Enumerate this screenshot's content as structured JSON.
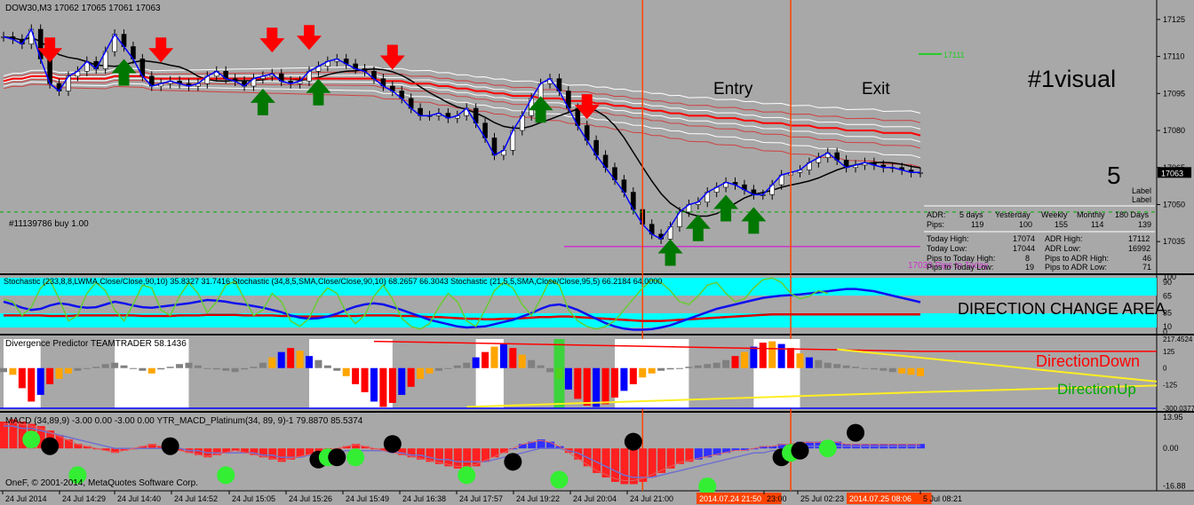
{
  "window": {
    "header": "DOW30,M3  17062 17065 17061 17063"
  },
  "price_axis": {
    "labels": [
      "17125",
      "17110",
      "17095",
      "17080",
      "17065",
      "17050",
      "17035"
    ],
    "current_price": "17063",
    "level_label": "17111"
  },
  "order_line": {
    "label": "#11139786 buy 1.00"
  },
  "pivot_line": {
    "label": "17033 Pips to Today"
  },
  "annotations": {
    "entry": "Entry",
    "exit": "Exit",
    "brand": "#1visual",
    "five": "5",
    "label1": "Label",
    "label2": "Label",
    "direction_change": "DIRECTION CHANGE AREA",
    "direction_down": "DirectionDown",
    "direction_up": "DirectionUp",
    "copyright": "OneF, © 2001-2014, MetaQuotes Software Corp."
  },
  "adr_panel": {
    "header": [
      "ADR:",
      "5 days",
      "Yesterday",
      "Weekly",
      "Monthly",
      "180 Days"
    ],
    "pips": [
      "Pips:",
      "119",
      "100",
      "155",
      "114",
      "139"
    ],
    "rows": [
      [
        "Today High:",
        "17074",
        "ADR High:",
        "17112"
      ],
      [
        "Today Low:",
        "17044",
        "ADR Low:",
        "16992"
      ],
      [
        "Pips to Today High:",
        "8",
        "Pips to ADR High:",
        "46"
      ],
      [
        "Pips to Today Low:",
        "19",
        "Pips to ADR Low:",
        "71"
      ]
    ]
  },
  "indicator_titles": {
    "stochastic": "Stochastic (233,8,8,LWMA,Close/Close,90,10) 35.8327 31.7416  Stochastic (34,8,5,SMA,Close/Close,90,10) 68.2657 66.3043  Stochastic (21,5,5,SMA,Close/Close,95,5) 66.2184 64.0000",
    "divergence": "Divergence Predictor TEAMTRADER 58.1436",
    "macd": "MACD (34,89,9) -3.00 0.00 -3.00 0.00  YTR_MACD_Platinum(34, 89, 9)-1 79.8870 85.5374"
  },
  "stoch_axis": [
    "100",
    "90",
    "65",
    "35",
    "10",
    "0"
  ],
  "div_axis": [
    "217.4524",
    "125",
    "0",
    "-125",
    "-300.0377"
  ],
  "macd_axis": [
    "13.95",
    "0.00",
    "-16.88"
  ],
  "time_axis": [
    "24 Jul 2014",
    "24 Jul 14:29",
    "24 Jul 14:40",
    "24 Jul 14:52",
    "24 Jul 15:05",
    "24 Jul 15:26",
    "24 Jul 15:49",
    "24 Jul 16:38",
    "24 Jul 17:57",
    "24 Jul 19:22",
    "24 Jul 20:04",
    "24 Jul 21:00",
    "2014.07.24 21:50",
    "23:00",
    "25 Jul 02:23",
    "2014.07.25 08:06",
    "5 Jul 08:21"
  ],
  "chart_data": {
    "type": "line",
    "title": "DOW30,M3",
    "ylim": [
      17025,
      17130
    ],
    "x_count": 100,
    "price_series": [
      17118,
      17117,
      17115,
      17121,
      17109,
      17099,
      17096,
      17102,
      17104,
      17108,
      17105,
      17112,
      17119,
      17114,
      17109,
      17102,
      17098,
      17099,
      17100,
      17099,
      17098,
      17099,
      17102,
      17104,
      17101,
      17100,
      17098,
      17101,
      17102,
      17103,
      17100,
      17099,
      17100,
      17104,
      17106,
      17108,
      17109,
      17107,
      17105,
      17104,
      17101,
      17098,
      17096,
      17093,
      17089,
      17086,
      17086,
      17087,
      17085,
      17086,
      17089,
      17083,
      17077,
      17070,
      17072,
      17080,
      17086,
      17093,
      17099,
      17101,
      17096,
      17089,
      17082,
      17076,
      17070,
      17065,
      17060,
      17055,
      17048,
      17042,
      17038,
      17036,
      17041,
      17047,
      17050,
      17051,
      17055,
      17057,
      17059,
      17058,
      17056,
      17054,
      17054,
      17058,
      17062,
      17063,
      17064,
      17067,
      17069,
      17071,
      17068,
      17065,
      17066,
      17067,
      17066,
      17065,
      17065,
      17064,
      17063,
      17063
    ],
    "ema_red": [
      17100,
      17101,
      17101,
      17102,
      17102,
      17102,
      17101,
      17101,
      17101,
      17101,
      17101,
      17101,
      17102,
      17102,
      17102,
      17102,
      17101,
      17101,
      17101,
      17101,
      17101,
      17101,
      17101,
      17101,
      17101,
      17101,
      17101,
      17101,
      17101,
      17101,
      17101,
      17101,
      17101,
      17101,
      17101,
      17101,
      17101,
      17101,
      17101,
      17101,
      17101,
      17100,
      17100,
      17100,
      17099,
      17099,
      17099,
      17098,
      17098,
      17097,
      17097,
      17096,
      17096,
      17095,
      17095,
      17094,
      17094,
      17094,
      17093,
      17093,
      17093,
      17092,
      17092,
      17092,
      17091,
      17091,
      17090,
      17090,
      17089,
      17089,
      17088,
      17088,
      17087,
      17087,
      17086,
      17086,
      17086,
      17085,
      17085,
      17085,
      17084,
      17084,
      17083,
      17083,
      17083,
      17082,
      17082,
      17082,
      17081,
      17081,
      17081,
      17080,
      17080,
      17080,
      17080,
      17079,
      17079,
      17079,
      17079,
      17078
    ],
    "entry_index": 69,
    "exit_index": 85,
    "signals": [
      {
        "type": "sell",
        "i": 5
      },
      {
        "type": "buy",
        "i": 13
      },
      {
        "type": "sell",
        "i": 17
      },
      {
        "type": "sell",
        "i": 29
      },
      {
        "type": "buy",
        "i": 28
      },
      {
        "type": "sell",
        "i": 33
      },
      {
        "type": "buy",
        "i": 34
      },
      {
        "type": "sell",
        "i": 42
      },
      {
        "type": "buy",
        "i": 58
      },
      {
        "type": "sell",
        "i": 63
      },
      {
        "type": "buy",
        "i": 72
      },
      {
        "type": "buy",
        "i": 75
      },
      {
        "type": "buy",
        "i": 78
      },
      {
        "type": "buy",
        "i": 81
      }
    ],
    "stochastic": {
      "ylim": [
        0,
        100
      ],
      "slow": [
        55,
        50,
        44,
        40,
        42,
        48,
        52,
        50,
        46,
        44,
        45,
        50,
        55,
        52,
        48,
        45,
        44,
        46,
        48,
        50,
        52,
        55,
        58,
        57,
        55,
        52,
        50,
        47,
        44,
        40,
        36,
        30,
        26,
        24,
        25,
        28,
        33,
        40,
        46,
        50,
        52,
        50,
        45,
        40,
        34,
        28,
        22,
        18,
        14,
        10,
        8,
        9,
        10,
        14,
        18,
        22,
        28,
        34,
        42,
        48,
        50,
        46,
        40,
        32,
        24,
        16,
        10,
        6,
        4,
        4,
        5,
        8,
        12,
        18,
        24,
        30,
        36,
        42,
        46,
        50,
        54,
        58,
        62,
        64,
        66,
        67,
        68,
        70,
        72,
        74,
        76,
        78,
        78,
        76,
        74,
        70,
        66,
        62,
        58,
        54
      ],
      "mid": [
        30,
        30,
        30,
        30,
        30,
        29,
        29,
        29,
        30,
        30,
        30,
        30,
        30,
        30,
        30,
        29,
        29,
        29,
        29,
        30,
        30,
        30,
        31,
        31,
        31,
        31,
        30,
        30,
        30,
        30,
        29,
        29,
        28,
        28,
        28,
        28,
        29,
        29,
        29,
        30,
        30,
        30,
        30,
        29,
        29,
        28,
        27,
        27,
        26,
        25,
        24,
        24,
        23,
        23,
        24,
        24,
        25,
        26,
        27,
        27,
        28,
        28,
        27,
        26,
        25,
        24,
        23,
        22,
        21,
        20,
        20,
        20,
        21,
        22,
        23,
        24,
        25,
        26,
        27,
        28,
        29,
        30,
        31,
        32,
        32,
        32,
        32,
        32,
        32,
        32,
        32,
        32,
        32,
        32,
        32,
        32,
        32,
        32,
        32,
        32
      ],
      "fast": [
        60,
        55,
        30,
        45,
        80,
        95,
        60,
        20,
        30,
        70,
        90,
        75,
        40,
        20,
        50,
        85,
        80,
        40,
        30,
        65,
        90,
        70,
        35,
        55,
        85,
        92,
        60,
        30,
        40,
        70,
        55,
        20,
        10,
        25,
        60,
        80,
        70,
        35,
        15,
        30,
        65,
        85,
        60,
        25,
        10,
        5,
        15,
        45,
        70,
        55,
        20,
        10,
        40,
        75,
        90,
        80,
        50,
        30,
        60,
        95,
        85,
        40,
        20,
        10,
        5,
        10,
        20,
        40,
        60,
        80,
        95,
        90,
        75,
        55,
        50,
        65,
        85,
        90,
        70,
        55,
        60,
        80,
        95,
        98,
        90,
        70,
        60,
        65,
        75,
        70
      ]
    },
    "divergence": {
      "ylim": [
        -300,
        217
      ],
      "bars": [
        -30,
        -50,
        -150,
        -250,
        -200,
        -120,
        -80,
        -40,
        -20,
        0,
        10,
        30,
        40,
        20,
        0,
        -20,
        -40,
        -10,
        10,
        30,
        40,
        20,
        0,
        -10,
        -20,
        -30,
        -10,
        10,
        40,
        80,
        120,
        150,
        130,
        90,
        60,
        20,
        -20,
        -60,
        -120,
        -180,
        -250,
        -290,
        -260,
        -200,
        -140,
        -80,
        -40,
        -20,
        0,
        20,
        40,
        80,
        120,
        160,
        180,
        150,
        100,
        60,
        20,
        -30,
        -80,
        -160,
        -230,
        -280,
        -290,
        -270,
        -220,
        -170,
        -120,
        -70,
        -40,
        -20,
        -10,
        0,
        10,
        20,
        30,
        40,
        60,
        90,
        120,
        160,
        190,
        200,
        180,
        150,
        110,
        80,
        60,
        40,
        30,
        20,
        10,
        0,
        -10,
        -20,
        -30,
        -40,
        -50,
        -60
      ]
    },
    "macd": {
      "ylim": [
        -17,
        14
      ],
      "hist": [
        12,
        13,
        12,
        11,
        10,
        8,
        6,
        4,
        2,
        1,
        0,
        -1,
        -2,
        -1,
        0,
        1,
        2,
        1,
        0,
        -1,
        -2,
        -3,
        -4,
        -3,
        -2,
        -1,
        -2,
        -3,
        -4,
        -5,
        -6,
        -5,
        -4,
        -3,
        -2,
        -1,
        0,
        1,
        2,
        1,
        0,
        -1,
        -2,
        -3,
        -4,
        -5,
        -6,
        -7,
        -8,
        -9,
        -9,
        -8,
        -6,
        -4,
        -2,
        0,
        2,
        3,
        4,
        3,
        1,
        -2,
        -5,
        -8,
        -11,
        -13,
        -15,
        -16,
        -16,
        -15,
        -13,
        -11,
        -9,
        -7,
        -6,
        -5,
        -4,
        -3,
        -2,
        -1,
        -1,
        0,
        1,
        1,
        2,
        2,
        3,
        3,
        3,
        3,
        3,
        2,
        2,
        2,
        2,
        2,
        2,
        2,
        2,
        2
      ],
      "signal": [
        10,
        10,
        9,
        9,
        8,
        7,
        6,
        5,
        4,
        3,
        2,
        1,
        0,
        0,
        0,
        0,
        0,
        0,
        0,
        0,
        -1,
        -1,
        -2,
        -2,
        -2,
        -2,
        -2,
        -2,
        -3,
        -3,
        -4,
        -4,
        -4,
        -3,
        -3,
        -2,
        -2,
        -1,
        -1,
        -1,
        -1,
        -1,
        -2,
        -2,
        -3,
        -3,
        -4,
        -5,
        -5,
        -6,
        -6,
        -6,
        -6,
        -5,
        -4,
        -3,
        -2,
        -1,
        0,
        0,
        0,
        -1,
        -2,
        -4,
        -6,
        -8,
        -10,
        -12,
        -13,
        -13,
        -13,
        -12,
        -11,
        -10,
        -9,
        -8,
        -7,
        -6,
        -5,
        -4,
        -3,
        -2,
        -2,
        -1,
        -1,
        0,
        0,
        1,
        1,
        1,
        1,
        1,
        1,
        1,
        1,
        1,
        1,
        1,
        1,
        1
      ],
      "dots": [
        {
          "c": "green",
          "i": 3,
          "v": 4
        },
        {
          "c": "black",
          "i": 5,
          "v": 1
        },
        {
          "c": "green",
          "i": 8,
          "v": -12
        },
        {
          "c": "black",
          "i": 18,
          "v": 1
        },
        {
          "c": "green",
          "i": 24,
          "v": -12
        },
        {
          "c": "black",
          "i": 34,
          "v": -5
        },
        {
          "c": "green",
          "i": 35,
          "v": -4
        },
        {
          "c": "black",
          "i": 36,
          "v": -4
        },
        {
          "c": "green",
          "i": 38,
          "v": -4
        },
        {
          "c": "black",
          "i": 42,
          "v": 2
        },
        {
          "c": "green",
          "i": 50,
          "v": -12
        },
        {
          "c": "black",
          "i": 55,
          "v": -6
        },
        {
          "c": "green",
          "i": 60,
          "v": -14
        },
        {
          "c": "black",
          "i": 68,
          "v": 3
        },
        {
          "c": "green",
          "i": 76,
          "v": -17
        },
        {
          "c": "black",
          "i": 84,
          "v": -4
        },
        {
          "c": "green",
          "i": 85,
          "v": -2
        },
        {
          "c": "black",
          "i": 86,
          "v": -1
        },
        {
          "c": "green",
          "i": 89,
          "v": 0
        },
        {
          "c": "black",
          "i": 92,
          "v": 7
        }
      ]
    }
  }
}
